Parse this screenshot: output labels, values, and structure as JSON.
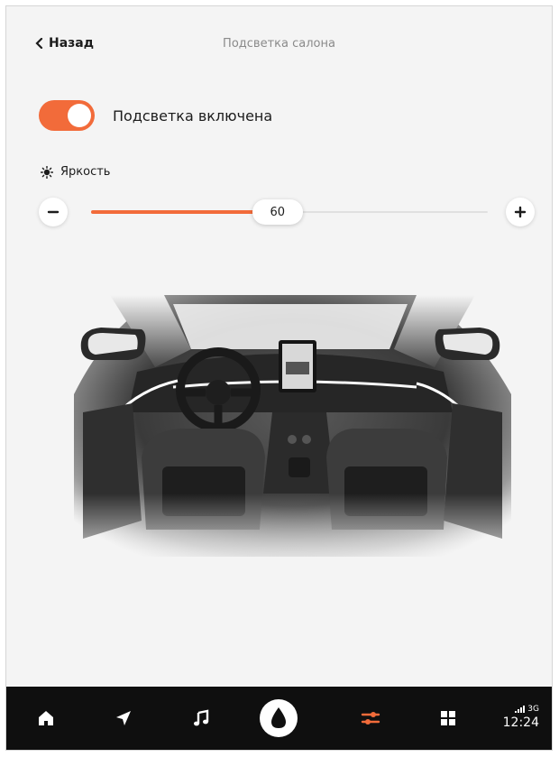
{
  "header": {
    "back_label": "Назад",
    "title": "Подсветка салона"
  },
  "lighting": {
    "toggle_on": true,
    "toggle_label": "Подсветка включена"
  },
  "brightness": {
    "label": "Яркость",
    "value": "60",
    "level": 0.47
  },
  "navbar": {
    "items": [
      "home-icon",
      "navigation-icon",
      "music-icon",
      "voice-assistant-icon",
      "settings-icon",
      "apps-icon"
    ],
    "active": "settings-icon",
    "network": "3G",
    "time": "12:24",
    "accent": "#f26b3a"
  }
}
